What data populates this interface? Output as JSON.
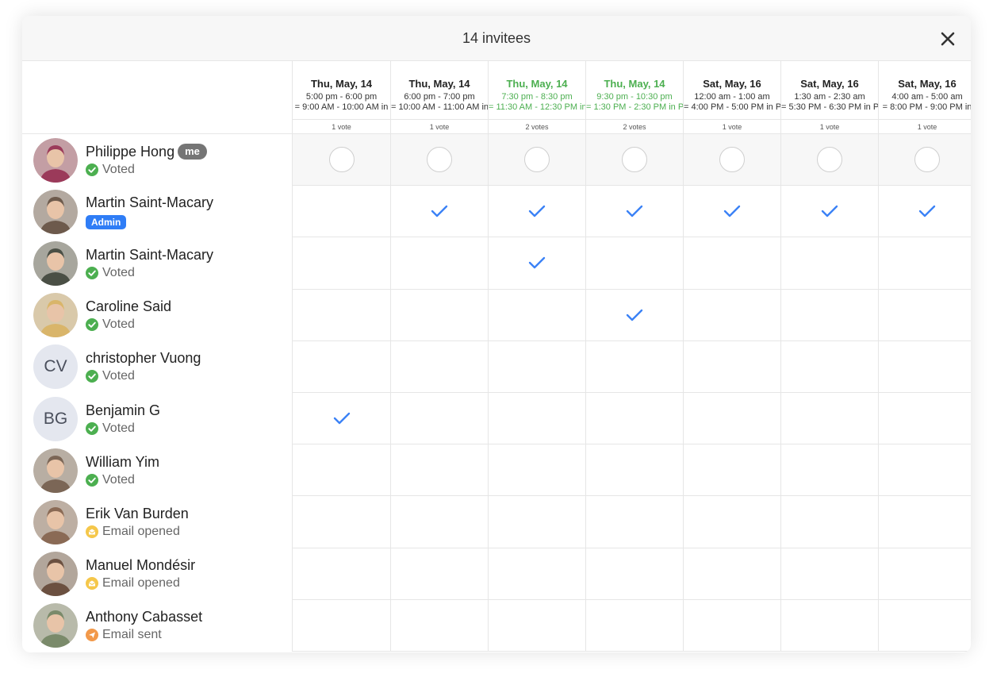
{
  "modal": {
    "title": "14 invitees",
    "close_icon": "close-icon"
  },
  "colors": {
    "accent_green": "#4caf50",
    "check_blue": "#3b82f6",
    "admin_blue": "#2f7df6"
  },
  "columns": [
    {
      "date": "Thu, May, 14",
      "time": "5:00 pm - 6:00 pm",
      "converted": "= 9:00 AM - 10:00 AM in",
      "votes": "1 vote",
      "highlight": false
    },
    {
      "date": "Thu, May, 14",
      "time": "6:00 pm - 7:00 pm",
      "converted": "= 10:00 AM - 11:00 AM in",
      "votes": "1 vote",
      "highlight": false
    },
    {
      "date": "Thu, May, 14",
      "time": "7:30 pm - 8:30 pm",
      "converted": "= 11:30 AM - 12:30 PM in",
      "votes": "2 votes",
      "highlight": true
    },
    {
      "date": "Thu, May, 14",
      "time": "9:30 pm - 10:30 pm",
      "converted": "= 1:30 PM - 2:30 PM in P",
      "votes": "2 votes",
      "highlight": true
    },
    {
      "date": "Sat, May, 16",
      "time": "12:00 am - 1:00 am",
      "converted": "= 4:00 PM - 5:00 PM in P",
      "votes": "1 vote",
      "highlight": false
    },
    {
      "date": "Sat, May, 16",
      "time": "1:30 am - 2:30 am",
      "converted": "= 5:30 PM - 6:30 PM in P",
      "votes": "1 vote",
      "highlight": false
    },
    {
      "date": "Sat, May, 16",
      "time": "4:00 am - 5:00 am",
      "converted": "= 8:00 PM - 9:00 PM in",
      "votes": "1 vote",
      "highlight": false
    }
  ],
  "invitees": [
    {
      "name": "Philippe Hong",
      "badge": "me",
      "status": "Voted",
      "status_type": "voted",
      "avatar": "photo",
      "avatar_color": "#9b3a5a",
      "is_me": true,
      "votes": [
        false,
        false,
        false,
        false,
        false,
        false,
        false
      ]
    },
    {
      "name": "Martin Saint-Macary",
      "admin": "Admin",
      "avatar": "photo",
      "avatar_color": "#6d5a4c",
      "votes": [
        false,
        true,
        true,
        true,
        true,
        true,
        true
      ]
    },
    {
      "name": "Martin Saint-Macary",
      "status": "Voted",
      "status_type": "voted",
      "avatar": "photo",
      "avatar_color": "#4a4f45",
      "votes": [
        false,
        false,
        true,
        false,
        false,
        false,
        false
      ]
    },
    {
      "name": "Caroline Said",
      "status": "Voted",
      "status_type": "voted",
      "avatar": "photo",
      "avatar_color": "#d9b56a",
      "votes": [
        false,
        false,
        false,
        true,
        false,
        false,
        false
      ]
    },
    {
      "name": "christopher Vuong",
      "status": "Voted",
      "status_type": "voted",
      "avatar": "initials",
      "initials": "CV",
      "votes": [
        false,
        false,
        false,
        false,
        false,
        false,
        false
      ]
    },
    {
      "name": "Benjamin G",
      "status": "Voted",
      "status_type": "voted",
      "avatar": "initials",
      "initials": "BG",
      "votes": [
        true,
        false,
        false,
        false,
        false,
        false,
        false
      ]
    },
    {
      "name": "William Yim",
      "status": "Voted",
      "status_type": "voted",
      "avatar": "photo",
      "avatar_color": "#7b6656",
      "votes": [
        false,
        false,
        false,
        false,
        false,
        false,
        false
      ]
    },
    {
      "name": "Erik Van Burden",
      "status": "Email opened",
      "status_type": "opened",
      "avatar": "photo",
      "avatar_color": "#8a6a55",
      "votes": [
        false,
        false,
        false,
        false,
        false,
        false,
        false
      ]
    },
    {
      "name": "Manuel Mondésir",
      "status": "Email opened",
      "status_type": "opened",
      "avatar": "photo",
      "avatar_color": "#6b5040",
      "votes": [
        false,
        false,
        false,
        false,
        false,
        false,
        false
      ]
    },
    {
      "name": "Anthony Cabasset",
      "status": "Email sent",
      "status_type": "sent",
      "avatar": "photo",
      "avatar_color": "#7a8a6a",
      "votes": [
        false,
        false,
        false,
        false,
        false,
        false,
        false
      ]
    }
  ]
}
